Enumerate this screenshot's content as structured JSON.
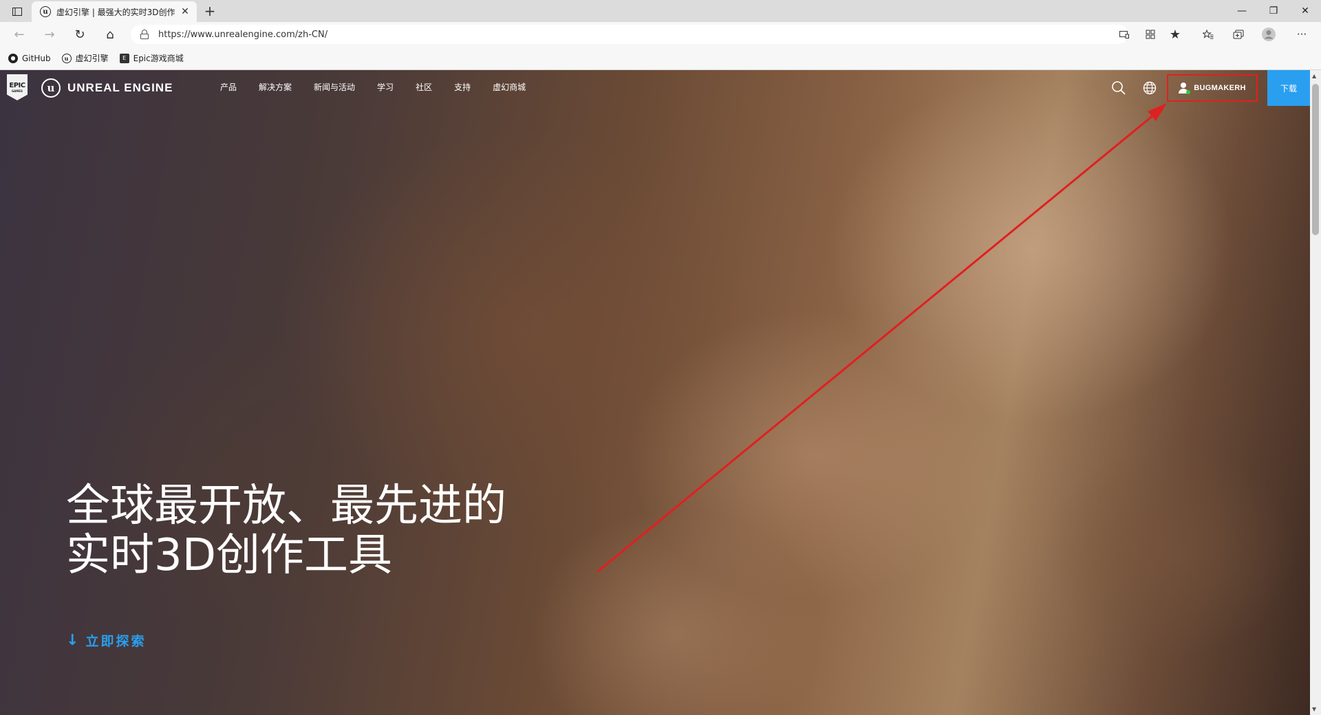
{
  "browser": {
    "tab": {
      "title": "虚幻引擎 | 最强大的实时3D创作",
      "close": "✕"
    },
    "new_tab": "+",
    "window_controls": {
      "minimize": "—",
      "restore": "❐",
      "close": "✕"
    },
    "nav": {
      "back": "←",
      "forward": "→",
      "refresh": "↻",
      "home": "⌂"
    },
    "url": "https://www.unrealengine.com/zh-CN/",
    "toolbar_icons": [
      "read-aloud-icon",
      "app-available-icon",
      "favorite-star-icon",
      "favorites-icon",
      "collections-icon",
      "profile-icon",
      "more-icon"
    ],
    "more_label": "···",
    "bookmarks": [
      {
        "label": "GitHub",
        "icon": "github-icon"
      },
      {
        "label": "虚幻引擎",
        "icon": "unreal-icon"
      },
      {
        "label": "Epic游戏商城",
        "icon": "epic-store-icon"
      }
    ]
  },
  "site": {
    "epic_logo": {
      "main": "EPIC",
      "sub": "GAMES"
    },
    "ue_mark": "u",
    "wordmark": "UNREAL ENGINE",
    "menu": [
      "产品",
      "解决方案",
      "新闻与活动",
      "学习",
      "社区",
      "支持",
      "虚幻商城"
    ],
    "user": "BUGMAKERH",
    "download": "下载",
    "hero": {
      "line1": "全球最开放、最先进的",
      "line2": "实时3D创作工具"
    },
    "explore": {
      "arrow": "↓",
      "label": "立即探索"
    }
  },
  "colors": {
    "accent_blue": "#2a9ff0",
    "annotation_red": "#e02020",
    "online_green": "#2ecc40"
  }
}
